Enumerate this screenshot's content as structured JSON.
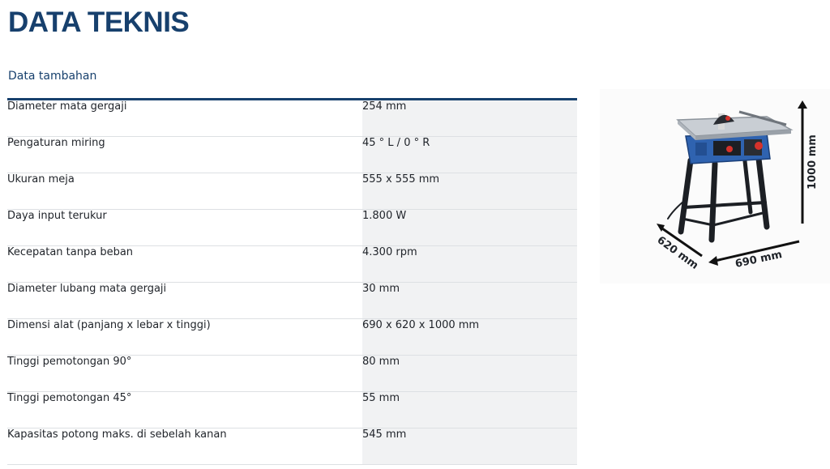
{
  "page": {
    "title": "DATA TEKNIS"
  },
  "section": {
    "title": "Data tambahan"
  },
  "specs": [
    {
      "label": "Diameter mata gergaji",
      "value": "254 mm"
    },
    {
      "label": "Pengaturan miring",
      "value": "45 ° L / 0 ° R"
    },
    {
      "label": "Ukuran meja",
      "value": "555 x 555 mm"
    },
    {
      "label": "Daya input terukur",
      "value": "1.800 W"
    },
    {
      "label": "Kecepatan tanpa beban",
      "value": "4.300 rpm"
    },
    {
      "label": "Diameter lubang mata gergaji",
      "value": "30 mm"
    },
    {
      "label": "Dimensi alat (panjang x lebar x tinggi)",
      "value": "690 x 620 x 1000 mm"
    },
    {
      "label": "Tinggi pemotongan 90°",
      "value": "80 mm"
    },
    {
      "label": "Tinggi pemotongan 45°",
      "value": "55 mm"
    },
    {
      "label": "Kapasitas potong maks. di sebelah kanan",
      "value": "545 mm"
    }
  ],
  "figure": {
    "height_label": "1000 mm",
    "depth_label": "620 mm",
    "width_label": "690 mm"
  },
  "colors": {
    "brand_blue": "#17406d",
    "tool_blue": "#2f63b0",
    "row_shade": "#f1f2f3",
    "accent_red": "#d6322b"
  }
}
